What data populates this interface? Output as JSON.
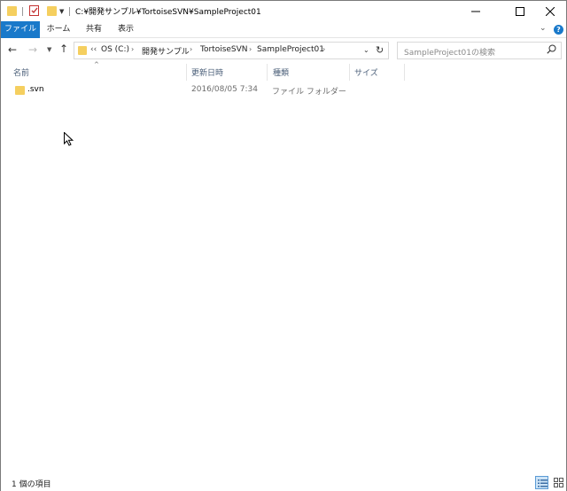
{
  "window": {
    "title": "C:¥開発サンプル¥TortoiseSVN¥SampleProject01",
    "minimize_icon": "minimize-icon",
    "maximize_icon": "maximize-icon",
    "close_icon": "close-icon"
  },
  "ribbon": {
    "tabs": [
      {
        "label": "ファイル",
        "active": true
      },
      {
        "label": "ホーム"
      },
      {
        "label": "共有"
      },
      {
        "label": "表示"
      }
    ]
  },
  "address": {
    "overflow": "‹‹",
    "crumbs": [
      "OS (C:)",
      "開発サンプル",
      "TortoiseSVN",
      "SampleProject01"
    ]
  },
  "search": {
    "placeholder": "SampleProject01の検索"
  },
  "columns": [
    "名前",
    "更新日時",
    "種類",
    "サイズ"
  ],
  "files": [
    {
      "name": ".svn",
      "date": "2016/08/05 7:34",
      "type": "ファイル フォルダー",
      "size": ""
    }
  ],
  "status": {
    "item_count": "1 個の項目"
  },
  "colors": {
    "accent": "#1979ca",
    "folder": "#f5cf5f"
  }
}
